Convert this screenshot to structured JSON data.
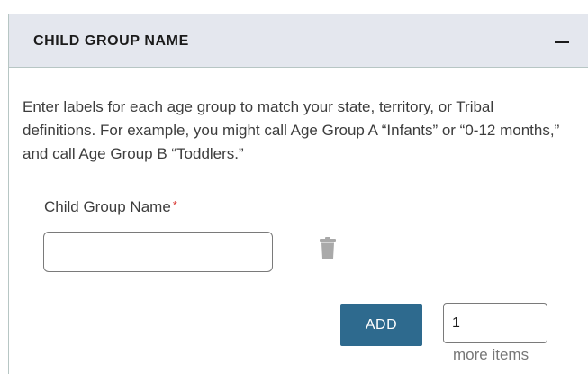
{
  "section": {
    "title": "CHILD GROUP NAME",
    "collapse_symbol": "—"
  },
  "intro": {
    "text": "Enter labels for each age group to match your state, territory, or Tribal definitions. For example, you might call Age Group A “Infants” or “0-12 months,” and call Age Group B “Toddlers.”"
  },
  "field": {
    "label": "Child Group Name",
    "required_marker": "*",
    "value": "",
    "delete_icon": "trash-icon"
  },
  "actions": {
    "add_label": "ADD",
    "item_count": "1",
    "more_items_label": "more items"
  },
  "colors": {
    "header_bg": "#e4e7ee",
    "primary_button": "#2e6a8e",
    "required": "#d83933"
  }
}
